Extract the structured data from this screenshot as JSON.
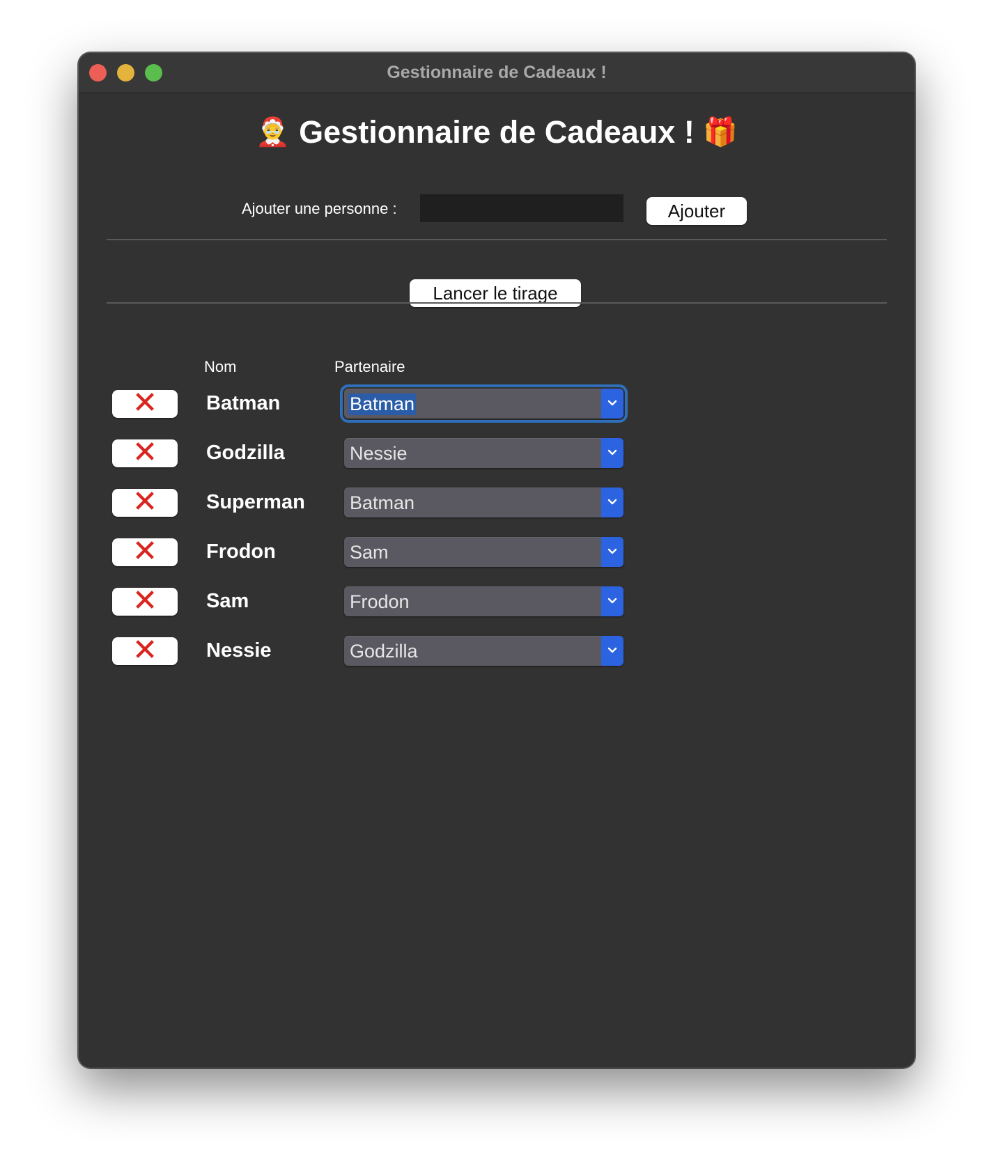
{
  "window": {
    "title": "Gestionnaire de Cadeaux !"
  },
  "header": {
    "title": "Gestionnaire de Cadeaux !",
    "emoji_left": "🤶",
    "emoji_right": "🎁"
  },
  "add_form": {
    "label": "Ajouter une personne :",
    "input_value": "",
    "button_label": "Ajouter"
  },
  "draw_button_label": "Lancer le tirage",
  "table": {
    "columns": [
      "Nom",
      "Partenaire"
    ],
    "delete_symbol": "✕",
    "rows": [
      {
        "name": "Batman",
        "partner": "Batman"
      },
      {
        "name": "Godzilla",
        "partner": "Nessie"
      },
      {
        "name": "Superman",
        "partner": "Batman"
      },
      {
        "name": "Frodon",
        "partner": "Sam"
      },
      {
        "name": "Sam",
        "partner": "Frodon"
      },
      {
        "name": "Nessie",
        "partner": "Godzilla"
      }
    ]
  },
  "colors": {
    "window_bg": "#323232",
    "delete_x": "#d8261e",
    "dropdown_chevron_bg": "#2c63e0",
    "focus_ring": "#2f6eb8"
  }
}
